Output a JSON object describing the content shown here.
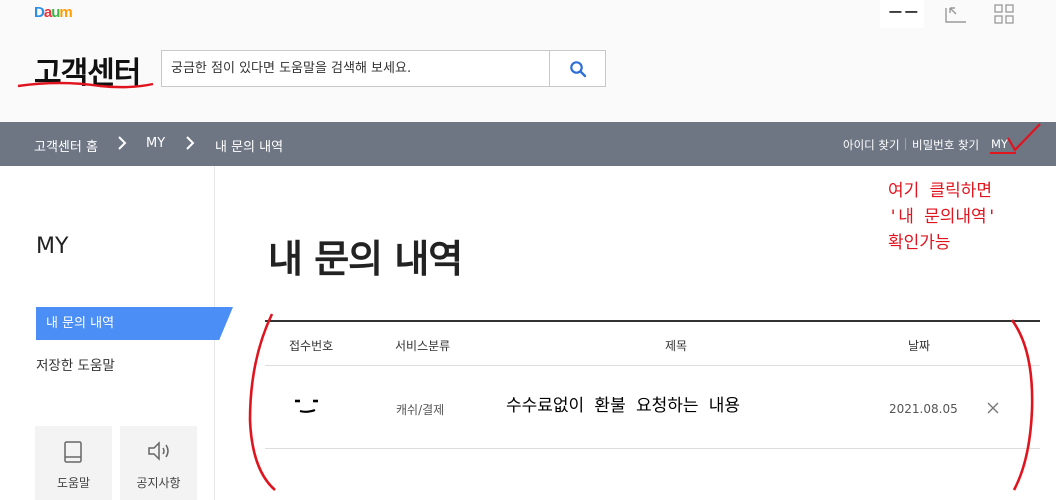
{
  "header": {
    "logo_letters": [
      "D",
      "a",
      "u",
      "m"
    ],
    "title": "고객센터",
    "masked_user": "ᅳᅳ",
    "search": {
      "placeholder": "궁금한 점이 있다면 도움말을 검색해 보세요.",
      "value": ""
    },
    "icons": {
      "profile": "user-box-icon",
      "apps": "grid-apps-icon",
      "search": "search-icon"
    }
  },
  "nav": {
    "breadcrumb": [
      "고객센터 홈",
      "MY",
      "내 문의 내역"
    ],
    "links": [
      "아이디 찾기",
      "비밀번호 찾기",
      "MY"
    ]
  },
  "annotation": {
    "lines": [
      "여기 클릭하면",
      "'내 문의내역'",
      "확인가능"
    ],
    "color": "#e0141e"
  },
  "sidebar": {
    "title": "MY",
    "active_item": "내 문의 내역",
    "item": "저장한 도움말",
    "tiles": [
      {
        "label": "도움말",
        "icon": "book-icon"
      },
      {
        "label": "공지사항",
        "icon": "speaker-icon"
      }
    ],
    "accent": "#4b8ef5"
  },
  "main": {
    "page_title": "내 문의 내역",
    "columns": [
      "접수번호",
      "서비스분류",
      "제목",
      "날짜"
    ],
    "rows": [
      {
        "id_masked": "ᄆ",
        "category": "캐쉬/결제",
        "subject": "수수료없이 환불 요청하는 내용",
        "date": "2021.08.05",
        "delete_icon": "close-icon"
      }
    ]
  },
  "colors": {
    "nav_bg": "#6e7684",
    "annotation_red": "#e0141e"
  }
}
